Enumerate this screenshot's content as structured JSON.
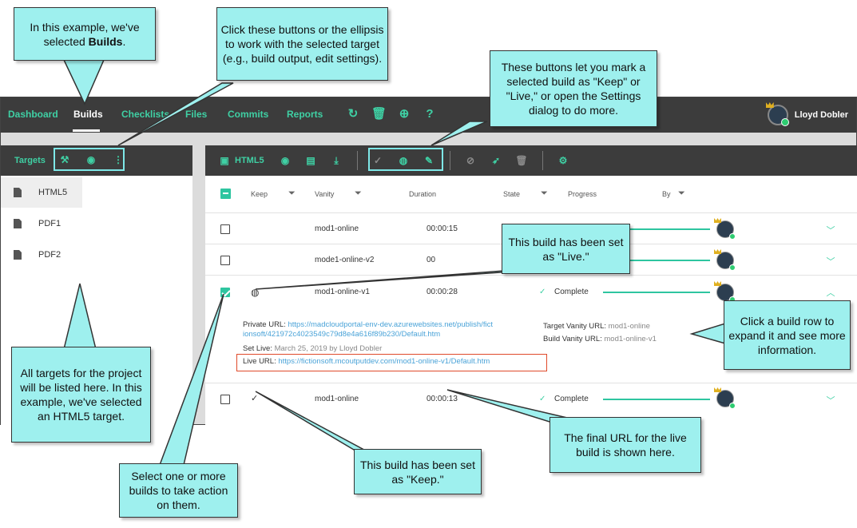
{
  "nav": {
    "items": [
      "Dashboard",
      "Builds",
      "Checklists",
      "Files",
      "Commits",
      "Reports"
    ],
    "active": "Builds",
    "user_name": "Lloyd Dobler",
    "icons": [
      "refresh-icon",
      "trash-icon",
      "search-zoom-icon",
      "help-icon"
    ]
  },
  "targets_panel": {
    "title": "Targets",
    "tools": [
      "build-icon",
      "eye-icon",
      "ellipsis-icon"
    ],
    "items": [
      {
        "name": "HTML5",
        "selected": true
      },
      {
        "name": "PDF1",
        "selected": false
      },
      {
        "name": "PDF2",
        "selected": false
      }
    ]
  },
  "builds_panel": {
    "title": "HTML5",
    "toolbar_icons": [
      "eye-icon",
      "clipboard-icon",
      "download-icon",
      "check-icon",
      "globe-icon",
      "pencil-icon",
      "cancel-icon",
      "rocket-icon",
      "trash-icon",
      "settings-icon"
    ],
    "columns": {
      "keep": "Keep",
      "vanity": "Vanity",
      "duration": "Duration",
      "state": "State",
      "progress": "Progress",
      "by": "By"
    },
    "rows": [
      {
        "checked": false,
        "keep": "",
        "vanity": "mod1-online",
        "duration": "00:00:15",
        "state": "",
        "progress": 1.0,
        "expanded": false
      },
      {
        "checked": false,
        "keep": "",
        "vanity": "mode1-online-v2",
        "duration": "00",
        "state": "",
        "progress": 1.0,
        "expanded": false
      },
      {
        "checked": true,
        "keep": "live",
        "vanity": "mod1-online-v1",
        "duration": "00:00:28",
        "state": "Complete",
        "progress": 1.0,
        "expanded": true
      },
      {
        "checked": false,
        "keep": "keep",
        "vanity": "mod1-online",
        "duration": "00:00:13",
        "state": "Complete",
        "progress": 1.0,
        "expanded": false
      }
    ],
    "details": {
      "private_url_label": "Private URL:",
      "private_url_line1": "https://madcloudportal-env-dev.azurewebsites.net/publish/fict",
      "private_url_line2": "ionsoft/421972c4023549c79d8e4a616f89b230/Default.htm",
      "set_live_label": "Set Live:",
      "set_live_value": "March 25, 2019 by Lloyd Dobler",
      "live_url_label": "Live URL:",
      "live_url_value": "https://fictionsoft.mcoutputdev.com/mod1-online-v1/Default.htm",
      "target_vanity_label": "Target Vanity URL:",
      "target_vanity_value": "mod1-online",
      "build_vanity_label": "Build Vanity URL:",
      "build_vanity_value": "mod1-online-v1"
    }
  },
  "callouts": {
    "builds_selected": [
      "In this example, we've",
      "selected ",
      "Builds",
      "."
    ],
    "buttons_target": "Click these buttons or the ellipsis to work with the selected target (e.g., build output, edit settings).",
    "keep_live_buttons": "These buttons let you mark a selected build as \"Keep\" or \"Live,\" or open the Settings dialog to do more.",
    "live_set": "This build has been set as \"Live.\"",
    "expand_row": "Click a build row to expand it and see more information.",
    "targets_listed": "All targets for the project will be listed here. In this example, we've selected an HTML5 target.",
    "final_url": "The final URL for the live build is shown here.",
    "keep_set": "This build has been set as \"Keep.\"",
    "select_builds": "Select one or more builds to take action on them."
  },
  "colors": {
    "accent": "#3fd0a4",
    "header_bg": "#3c3c3c",
    "callout_bg": "#9ef0ee",
    "highlight_box": "#7ee8e8",
    "live_url_box": "#e04a2a"
  }
}
